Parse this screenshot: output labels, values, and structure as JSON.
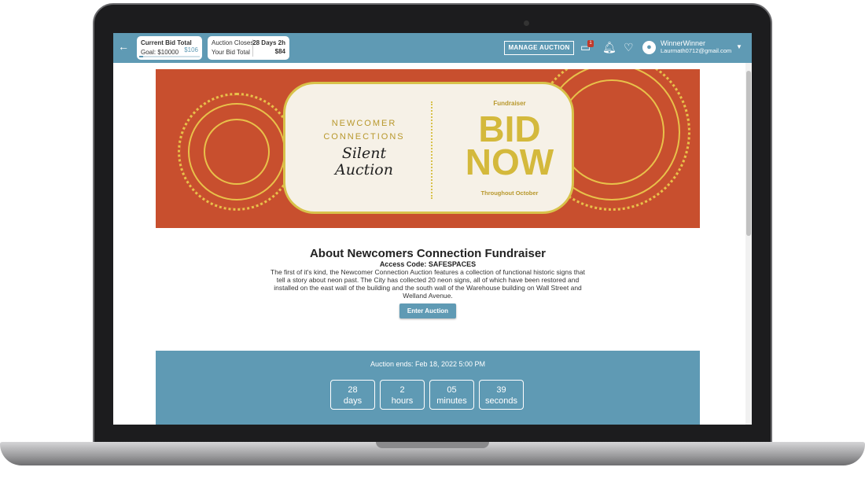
{
  "header": {
    "back_icon": "arrow-left-icon",
    "current_bid_label": "Current Bid Total",
    "current_bid_value": "$106",
    "goal": "Goal: $10000",
    "goal_progress": 0.0106,
    "closes_label": "Auction Closes",
    "closes_value": "28 Days 2h",
    "your_bid_label": "Your Bid Total",
    "your_bid_value": "$84",
    "manage_label": "MANAGE AUCTION",
    "messages_badge": "1",
    "user_name": "WinnerWinner",
    "user_email": "Laurmath0712@gmail.com"
  },
  "banner": {
    "left_line1": "NEWCOMER",
    "left_line2": "CONNECTIONS",
    "script1": "Silent",
    "script2": "Auction",
    "fundraiser": "Fundraiser",
    "bid": "BID",
    "now": "NOW",
    "throughout": "Throughout October",
    "colors": {
      "background": "#c84f2e",
      "gold": "#d4b93c"
    }
  },
  "about": {
    "title": "About Newcomers Connection Fundraiser",
    "access_code": "Access Code: SAFESPACES",
    "description": "The first of it's kind, the Newcomer Connection Auction features a collection of functional historic signs that tell a story about neon past. The City has collected 20 neon signs, all of which have been restored and installed on the east wall of the building and the south wall of the Warehouse building on Wall Street and Welland Avenue.",
    "enter_label": "Enter Auction"
  },
  "countdown": {
    "ends": "Auction ends: Feb 18, 2022 5:00 PM",
    "units": [
      {
        "value": "28",
        "label": "days"
      },
      {
        "value": "2",
        "label": "hours"
      },
      {
        "value": "05",
        "label": "minutes"
      },
      {
        "value": "39",
        "label": "seconds"
      }
    ]
  },
  "theme": {
    "accent": "#5f9ab4"
  }
}
